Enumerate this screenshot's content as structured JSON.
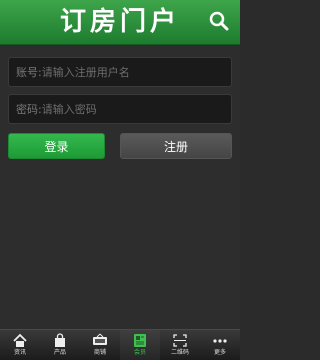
{
  "header": {
    "title": "订房门户"
  },
  "form": {
    "account_label": "账号:",
    "account_placeholder": "请输入注册用户名",
    "password_label": "密码:",
    "password_placeholder": "请输入密码",
    "login_label": "登录",
    "register_label": "注册"
  },
  "tabs": [
    {
      "label": "资讯",
      "icon": "home-icon"
    },
    {
      "label": "产品",
      "icon": "shopping-bag-icon"
    },
    {
      "label": "商铺",
      "icon": "shop-sign-icon"
    },
    {
      "label": "会员",
      "icon": "member-card-icon",
      "active": true
    },
    {
      "label": "二维码",
      "icon": "qr-code-icon"
    },
    {
      "label": "更多",
      "icon": "more-dots-icon"
    }
  ],
  "colors": {
    "accent": "#2aa843",
    "background": "#2b2b2b"
  }
}
